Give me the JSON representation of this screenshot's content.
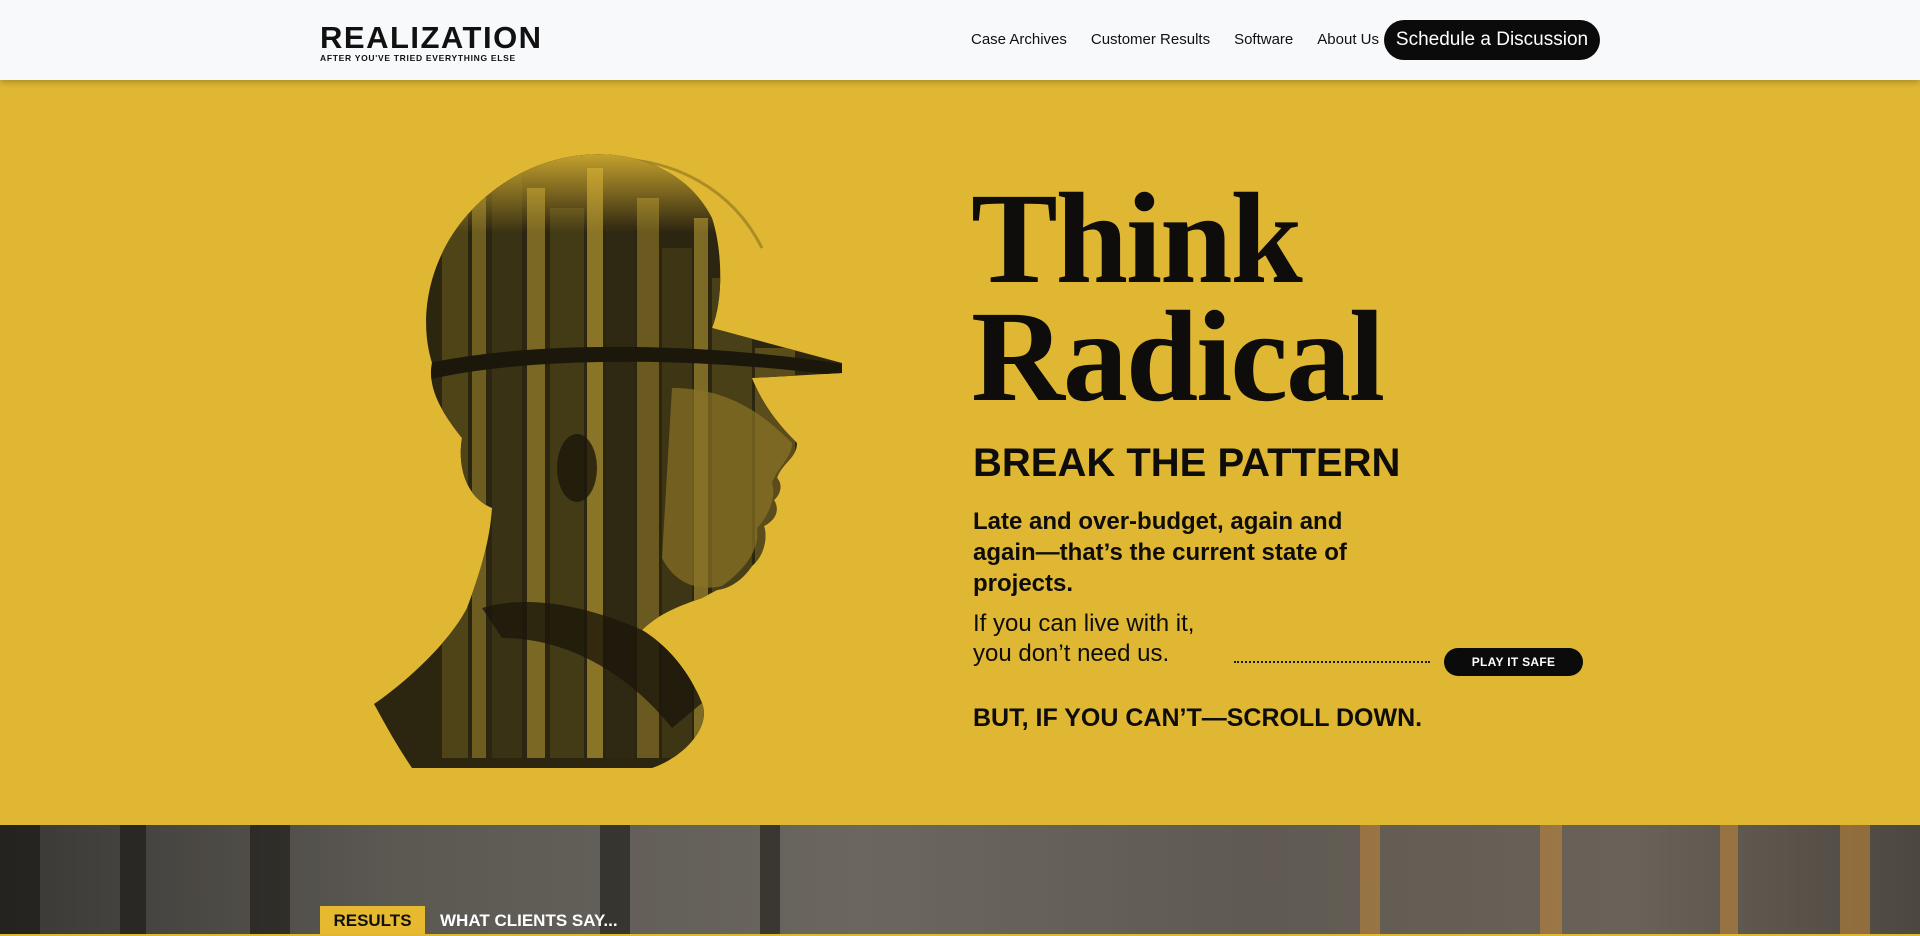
{
  "header": {
    "logo": {
      "wordmark": "REALIZATION",
      "tagline": "AFTER YOU'VE TRIED EVERYTHING ELSE"
    },
    "nav": [
      {
        "label": "Case Archives"
      },
      {
        "label": "Customer Results"
      },
      {
        "label": "Software"
      },
      {
        "label": "About Us"
      }
    ],
    "cta_label": "Schedule a Discussion"
  },
  "hero": {
    "title_line1": "Think",
    "title_line2": "Radical",
    "subtitle": "BREAK THE PATTERN",
    "lead": "Late and over-budget, again and again—that’s the current state of projects.",
    "body_line1": "If you can live with it,",
    "body_line2": "you don’t need us.",
    "play_safe_label": "PLAY IT  SAFE",
    "scroll_text": "BUT, IF YOU CAN’T—SCROLL DOWN.",
    "image_icon": "construction-worker-silhouette"
  },
  "results": {
    "tag_label": "RESULTS",
    "heading": "WHAT CLIENTS SAY..."
  },
  "colors": {
    "hero_background": "#dfb733",
    "header_background": "#f8f9fb",
    "button_background": "#0b0b0b",
    "accent_yellow": "#e7b931"
  }
}
